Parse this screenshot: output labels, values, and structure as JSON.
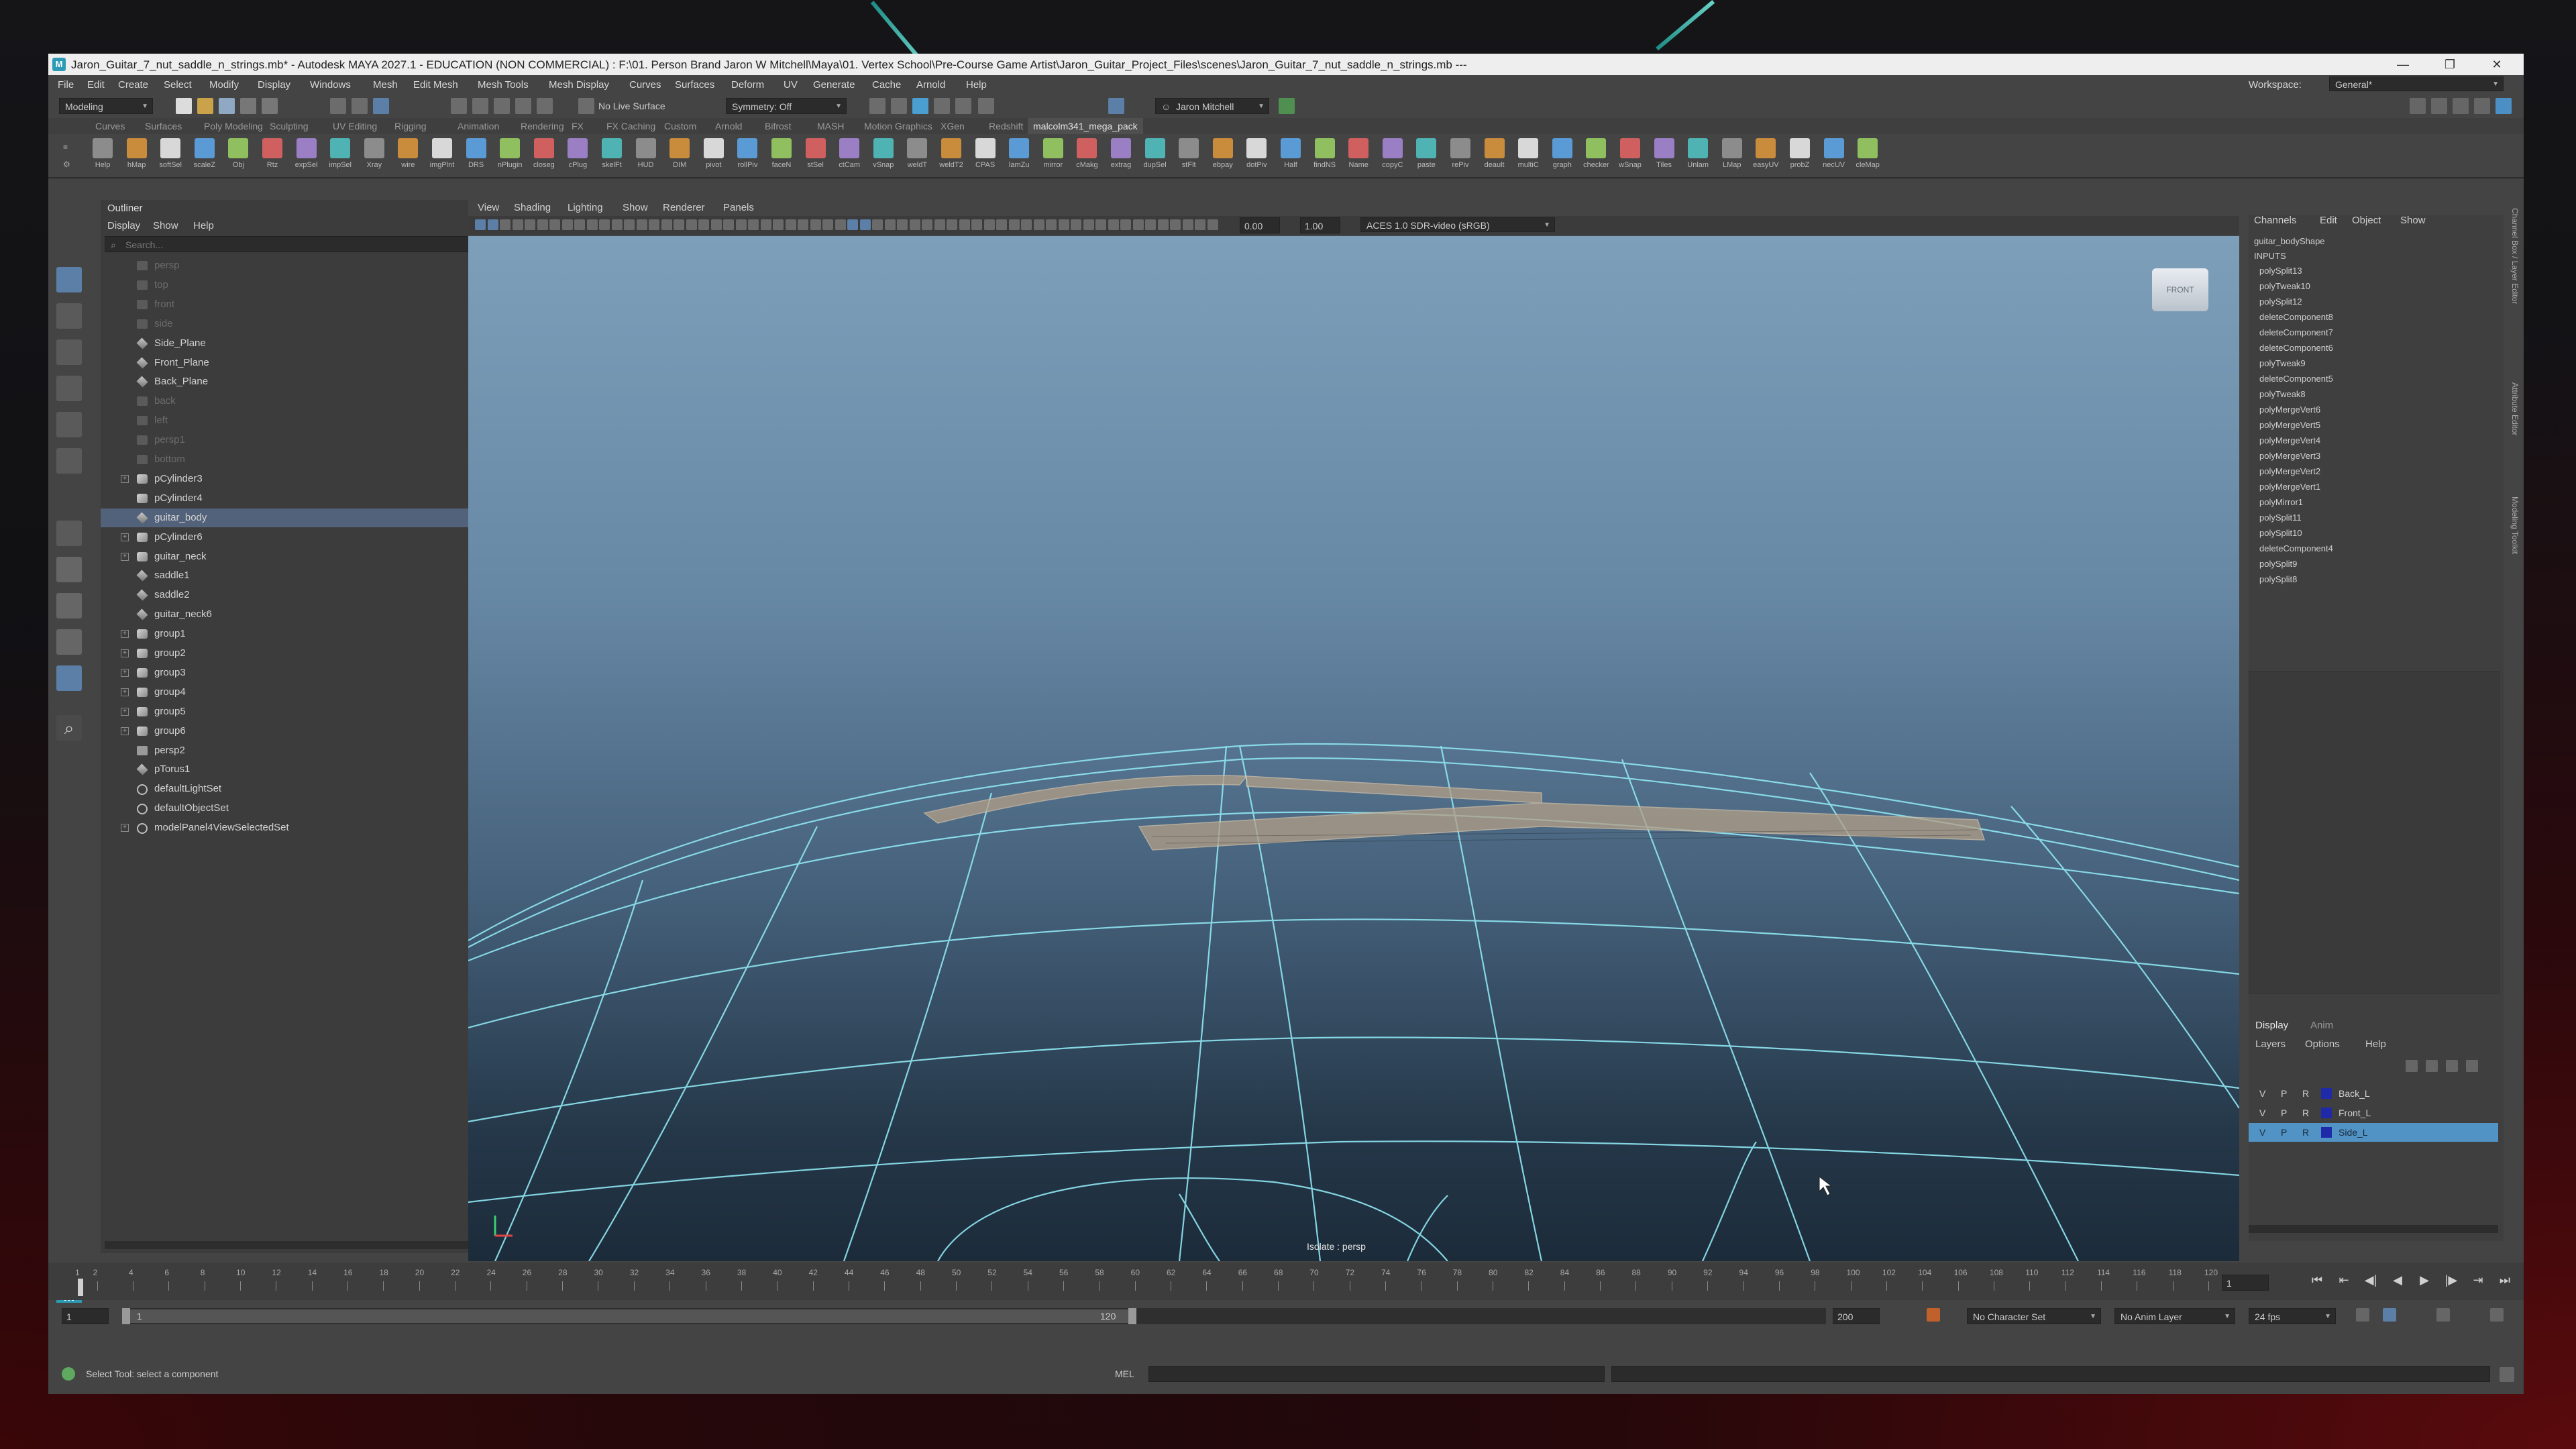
{
  "window": {
    "title": "Jaron_Guitar_7_nut_saddle_n_strings.mb* - Autodesk MAYA 2027.1 - EDUCATION (NON COMMERCIAL) : F:\\01. Person Brand Jaron W Mitchell\\Maya\\01. Vertex School\\Pre-Course Game Artist\\Jaron_Guitar_Project_Files\\scenes\\Jaron_Guitar_7_nut_saddle_n_strings.mb ---",
    "app_icon": "maya-icon",
    "controls": [
      "—",
      "❐",
      "✕"
    ]
  },
  "menubar": {
    "items": [
      "File",
      "Edit",
      "Create",
      "Select",
      "Modify",
      "Display",
      "Windows",
      "Mesh",
      "Edit Mesh",
      "Mesh Tools",
      "Mesh Display",
      "Curves",
      "Surfaces",
      "Deform",
      "UV",
      "Generate",
      "Cache",
      "Arnold",
      "Help"
    ],
    "workspace_label": "Workspace:",
    "workspace_value": "General*"
  },
  "statusline": {
    "mode": "Modeling",
    "live_surface": "No Live Surface",
    "symmetry": "Symmetry: Off",
    "user": "Jaron Mitchell"
  },
  "shelf": {
    "tabs": [
      "Curves",
      "Surfaces",
      "Poly Modeling",
      "Sculpting",
      "UV Editing",
      "Rigging",
      "Animation",
      "Rendering",
      "FX",
      "FX Caching",
      "Custom",
      "Arnold",
      "Bifrost",
      "MASH",
      "Motion Graphics",
      "XGen",
      "Redshift",
      "malcolm341_mega_pack"
    ],
    "active_tab": "malcolm341_mega_pack",
    "icons": [
      "Help",
      "hMap",
      "softSel",
      "scaleZ",
      "Obj",
      "Rtz",
      "expSel",
      "impSel",
      "Xray",
      "wire",
      "imgPlnt",
      "DRS",
      "nPlugin",
      "closeg",
      "cPlug",
      "skelFt",
      "HUD",
      "DIM",
      "pivot",
      "rollPiv",
      "faceN",
      "stSel",
      "ctCam",
      "vSnap",
      "weldT",
      "weldT2",
      "CPAS",
      "lamZu",
      "mirror",
      "cMakg",
      "extrag",
      "dupSel",
      "stFlt",
      "ebpay",
      "dotPiv",
      "Half",
      "findNS",
      "Name",
      "copyC",
      "paste",
      "rePiv",
      "deault",
      "multiC",
      "graph",
      "checker",
      "wSnap",
      "Tiles",
      "Unlam",
      "LMap",
      "easyUV",
      "probZ",
      "necUV",
      "cleMap"
    ]
  },
  "outliner": {
    "title": "Outliner",
    "menu": [
      "Display",
      "Show",
      "Help"
    ],
    "search_placeholder": "Search...",
    "rows": [
      {
        "label": "persp",
        "type": "camera",
        "dim": true
      },
      {
        "label": "top",
        "type": "camera",
        "dim": true
      },
      {
        "label": "front",
        "type": "camera",
        "dim": true
      },
      {
        "label": "side",
        "type": "camera",
        "dim": true
      },
      {
        "label": "Side_Plane",
        "type": "mesh"
      },
      {
        "label": "Front_Plane",
        "type": "mesh"
      },
      {
        "label": "Back_Plane",
        "type": "mesh"
      },
      {
        "label": "back",
        "type": "camera",
        "dim": true
      },
      {
        "label": "left",
        "type": "camera",
        "dim": true
      },
      {
        "label": "persp1",
        "type": "camera",
        "dim": true
      },
      {
        "label": "bottom",
        "type": "camera",
        "dim": true
      },
      {
        "label": "pCylinder3",
        "type": "group",
        "expandable": true
      },
      {
        "label": "pCylinder4",
        "type": "group"
      },
      {
        "label": "guitar_body",
        "type": "mesh",
        "selected": true
      },
      {
        "label": "pCylinder6",
        "type": "group",
        "expandable": true
      },
      {
        "label": "guitar_neck",
        "type": "group",
        "expandable": true
      },
      {
        "label": "saddle1",
        "type": "mesh"
      },
      {
        "label": "saddle2",
        "type": "mesh"
      },
      {
        "label": "guitar_neck6",
        "type": "mesh"
      },
      {
        "label": "group1",
        "type": "group",
        "expandable": true
      },
      {
        "label": "group2",
        "type": "group",
        "expandable": true
      },
      {
        "label": "group3",
        "type": "group",
        "expandable": true
      },
      {
        "label": "group4",
        "type": "group",
        "expandable": true
      },
      {
        "label": "group5",
        "type": "group",
        "expandable": true
      },
      {
        "label": "group6",
        "type": "group",
        "expandable": true
      },
      {
        "label": "persp2",
        "type": "camera"
      },
      {
        "label": "pTorus1",
        "type": "mesh"
      },
      {
        "label": "defaultLightSet",
        "type": "set"
      },
      {
        "label": "defaultObjectSet",
        "type": "set"
      },
      {
        "label": "modelPanel4ViewSelectedSet",
        "type": "set",
        "expandable": true
      }
    ]
  },
  "viewport": {
    "menu": [
      "View",
      "Shading",
      "Lighting",
      "Show",
      "Renderer",
      "Panels"
    ],
    "exposure": "0.00",
    "gamma": "1.00",
    "color_space": "ACES 1.0 SDR-video (sRGB)",
    "camera_label": "Isolate : persp",
    "viewcube_label": "FRONT"
  },
  "channel_box": {
    "menu": [
      "Channels",
      "Edit",
      "Object",
      "Show"
    ],
    "shape": "guitar_bodyShape",
    "inputs_label": "INPUTS",
    "inputs": [
      "polySplit13",
      "polyTweak10",
      "polySplit12",
      "deleteComponent8",
      "deleteComponent7",
      "deleteComponent6",
      "polyTweak9",
      "deleteComponent5",
      "polyTweak8",
      "polyMergeVert6",
      "polyMergeVert5",
      "polyMergeVert4",
      "polyMergeVert3",
      "polyMergeVert2",
      "polyMergeVert1",
      "polyMirror1",
      "polySplit11",
      "polySplit10",
      "deleteComponent4",
      "polySplit9",
      "polySplit8"
    ],
    "side_tabs": [
      "Channel Box / Layer Editor",
      "Attribute Editor",
      "Modeling Toolkit"
    ]
  },
  "layer_editor": {
    "tabs": [
      "Display",
      "Anim"
    ],
    "menu": [
      "Layers",
      "Options",
      "Help"
    ],
    "layers": [
      {
        "v": "V",
        "p": "P",
        "r": "R",
        "name": "Back_L",
        "selected": false
      },
      {
        "v": "V",
        "p": "P",
        "r": "R",
        "name": "Front_L",
        "selected": false
      },
      {
        "v": "V",
        "p": "P",
        "r": "R",
        "name": "Side_L",
        "selected": true
      }
    ]
  },
  "timeslider": {
    "ticks": [
      "1",
      "2",
      "4",
      "6",
      "8",
      "10",
      "12",
      "14",
      "16",
      "18",
      "20",
      "22",
      "24",
      "26",
      "28",
      "30",
      "32",
      "34",
      "36",
      "38",
      "40",
      "42",
      "44",
      "46",
      "48",
      "50",
      "52",
      "54",
      "56",
      "58",
      "60",
      "62",
      "64",
      "66",
      "68",
      "70",
      "72",
      "74",
      "76",
      "78",
      "80",
      "82",
      "84",
      "86",
      "88",
      "90",
      "92",
      "94",
      "96",
      "98",
      "100",
      "102",
      "104",
      "106",
      "108",
      "110",
      "112",
      "114",
      "116",
      "118",
      "120"
    ],
    "current_frame": "1"
  },
  "rangeslider": {
    "start": "1",
    "start_inner": "1",
    "end_inner": "120",
    "end": "200",
    "character_set": "No Character Set",
    "anim_layer": "No Anim Layer",
    "fps": "24 fps"
  },
  "commandline": {
    "help": "Select Tool: select a component",
    "lang": "MEL"
  }
}
